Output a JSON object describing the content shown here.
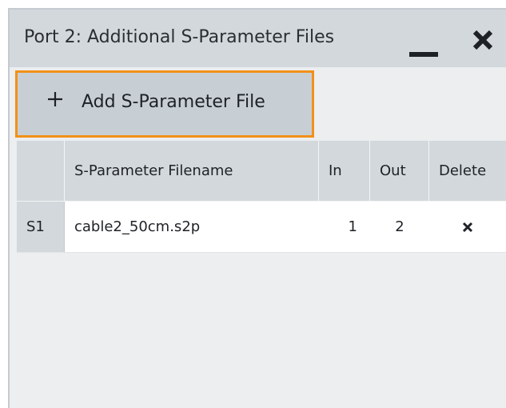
{
  "window": {
    "title": "Port 2: Additional S-Parameter Files",
    "minimize_icon": "minimize-icon",
    "close_icon": "close-icon"
  },
  "toolbar": {
    "add_icon": "plus-icon",
    "add_label": "Add S-Parameter File",
    "focus_color": "#f29018"
  },
  "table": {
    "columns": [
      "",
      "S-Parameter Filename",
      "In",
      "Out",
      "Delete"
    ],
    "rows": [
      {
        "id": "S1",
        "filename": "cable2_50cm.s2p",
        "in": "1",
        "out": "2",
        "delete_icon": "delete-x-icon"
      }
    ]
  }
}
